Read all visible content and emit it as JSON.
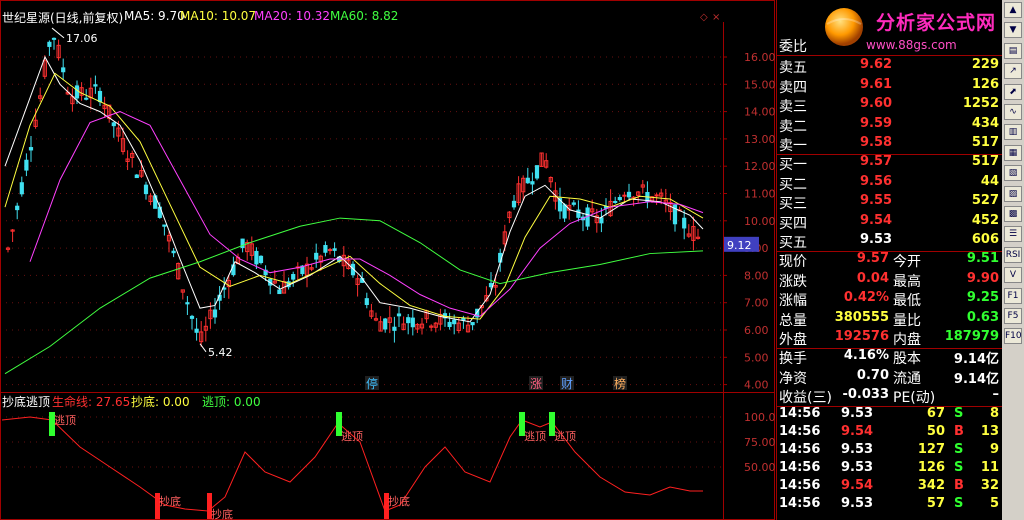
{
  "header": {
    "title": "世纪星源(日线,前复权)",
    "ma5": "MA5: 9.70",
    "ma10": "MA10: 10.07",
    "ma20": "MA20: 10.32",
    "ma60": "MA60: 8.82"
  },
  "main_chart": {
    "y_ticks": [
      "16.00",
      "15.00",
      "14.00",
      "13.00",
      "12.00",
      "11.00",
      "10.00",
      "9.00",
      "8.00",
      "7.00",
      "6.00",
      "5.00",
      "4.00"
    ],
    "high_label": "17.06",
    "low_label": "5.42",
    "last_price_tag": "9.12",
    "event_markers": [
      "停",
      "涨",
      "财",
      "榜"
    ]
  },
  "indicator": {
    "name": "抄底逃顶",
    "line1": "生命线: 27.65",
    "line2": "抄底: 0.00",
    "line3": "逃顶: 0.00",
    "y_ticks": [
      "100.00",
      "75.00",
      "50.00"
    ],
    "top_labels": [
      "逃顶",
      "逃顶",
      "逃顶",
      "逃顶"
    ],
    "bottom_labels": [
      "抄底",
      "抄底",
      "抄底"
    ]
  },
  "logo": {
    "title": "分析家公式网",
    "url": "www.88gs.com"
  },
  "order_book": {
    "ratio_label": "委比",
    "asks": [
      {
        "label": "卖五",
        "price": "9.62",
        "vol": "229"
      },
      {
        "label": "卖四",
        "price": "9.61",
        "vol": "126"
      },
      {
        "label": "卖三",
        "price": "9.60",
        "vol": "1252"
      },
      {
        "label": "卖二",
        "price": "9.59",
        "vol": "434"
      },
      {
        "label": "卖一",
        "price": "9.58",
        "vol": "517"
      }
    ],
    "bids": [
      {
        "label": "买一",
        "price": "9.57",
        "vol": "517"
      },
      {
        "label": "买二",
        "price": "9.56",
        "vol": "44"
      },
      {
        "label": "买三",
        "price": "9.55",
        "vol": "527"
      },
      {
        "label": "买四",
        "price": "9.54",
        "vol": "452"
      },
      {
        "label": "买五",
        "price": "9.53",
        "vol": "606"
      }
    ]
  },
  "quote": [
    {
      "l1": "现价",
      "v1": "9.57",
      "l2": "今开",
      "v2": "9.51",
      "c1": "#ff3030",
      "c2": "#30ff30"
    },
    {
      "l1": "涨跌",
      "v1": "0.04",
      "l2": "最高",
      "v2": "9.90",
      "c1": "#ff3030",
      "c2": "#ff3030"
    },
    {
      "l1": "涨幅",
      "v1": "0.42%",
      "l2": "最低",
      "v2": "9.25",
      "c1": "#ff3030",
      "c2": "#30ff30"
    },
    {
      "l1": "总量",
      "v1": "380555",
      "l2": "量比",
      "v2": "0.63",
      "c1": "#ffff40",
      "c2": "#30ff30"
    },
    {
      "l1": "外盘",
      "v1": "192576",
      "l2": "内盘",
      "v2": "187979",
      "c1": "#ff3030",
      "c2": "#30ff30"
    }
  ],
  "fundamentals": [
    {
      "l1": "换手",
      "v1": "4.16%",
      "l2": "股本",
      "v2": "9.14亿"
    },
    {
      "l1": "净资",
      "v1": "0.70",
      "l2": "流通",
      "v2": "9.14亿"
    },
    {
      "l1": "收益(三)",
      "v1": "-0.033",
      "l2": "PE(动)",
      "v2": "–"
    }
  ],
  "ticks": [
    {
      "time": "14:56",
      "price": "9.53",
      "vol": "67",
      "side": "S",
      "n": "8",
      "pc": "#ffffff",
      "sc": "#30ff30"
    },
    {
      "time": "14:56",
      "price": "9.54",
      "vol": "50",
      "side": "B",
      "n": "13",
      "pc": "#ff3030",
      "sc": "#ff3030"
    },
    {
      "time": "14:56",
      "price": "9.53",
      "vol": "127",
      "side": "S",
      "n": "9",
      "pc": "#ffffff",
      "sc": "#30ff30"
    },
    {
      "time": "14:56",
      "price": "9.53",
      "vol": "126",
      "side": "S",
      "n": "11",
      "pc": "#ffffff",
      "sc": "#30ff30"
    },
    {
      "time": "14:56",
      "price": "9.54",
      "vol": "342",
      "side": "B",
      "n": "32",
      "pc": "#ff3030",
      "sc": "#ff3030"
    },
    {
      "time": "14:56",
      "price": "9.53",
      "vol": "57",
      "side": "S",
      "n": "5",
      "pc": "#ffffff",
      "sc": "#30ff30"
    }
  ],
  "toolbar_icons": [
    "arrow-up-icon",
    "arrow-down-icon",
    "doc-icon",
    "chart-icon",
    "chart2-icon",
    "wave-icon",
    "bars-icon",
    "grid-icon",
    "layers-icon",
    "table-icon",
    "table2-icon",
    "list-icon",
    "rsi-icon",
    "vol-icon",
    "f1-icon",
    "f5-icon",
    "f10-icon"
  ],
  "toolbar_labels": [
    "▲",
    "▼",
    "▤",
    "↗",
    "⬈",
    "∿",
    "▥",
    "▦",
    "▧",
    "▨",
    "▩",
    "☰",
    "RSI",
    "V",
    "F1",
    "F5",
    "F10"
  ]
}
